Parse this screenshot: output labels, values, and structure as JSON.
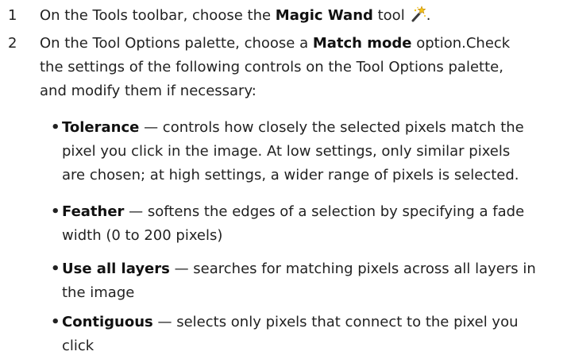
{
  "steps": [
    {
      "number": "1",
      "pre": "On the Tools toolbar, choose the ",
      "bold": "Magic Wand",
      "post": " tool",
      "icon": "magic-wand-icon",
      "end": "."
    },
    {
      "number": "2",
      "line1_pre": "On the Tool Options palette, choose a ",
      "line1_bold": "Match mode",
      "line1_post": " option.Check",
      "line2": "the settings of the following controls on the Tool Options palette,",
      "line3": "and modify them if necessary:"
    }
  ],
  "bullets": [
    {
      "term": "Tolerance",
      "line1": " — controls how closely the selected pixels match the",
      "line2": "pixel you click in the image. At low settings, only similar pixels",
      "line3": "are chosen; at high settings, a wider range of pixels is selected."
    },
    {
      "term": "Feather",
      "line1": " — softens the edges of a selection by specifying a fade",
      "line2": "width (0 to 200 pixels)"
    },
    {
      "term": "Use all layers",
      "line1": " — searches for matching pixels across all layers in",
      "line2": "the image"
    },
    {
      "term": "Contiguous",
      "line1": " — selects only pixels that connect to the pixel you",
      "line2": "click"
    }
  ],
  "colors": {
    "text": "#222222",
    "wand_handle": "#3a3a3a",
    "wand_tip": "#f3c21a"
  }
}
